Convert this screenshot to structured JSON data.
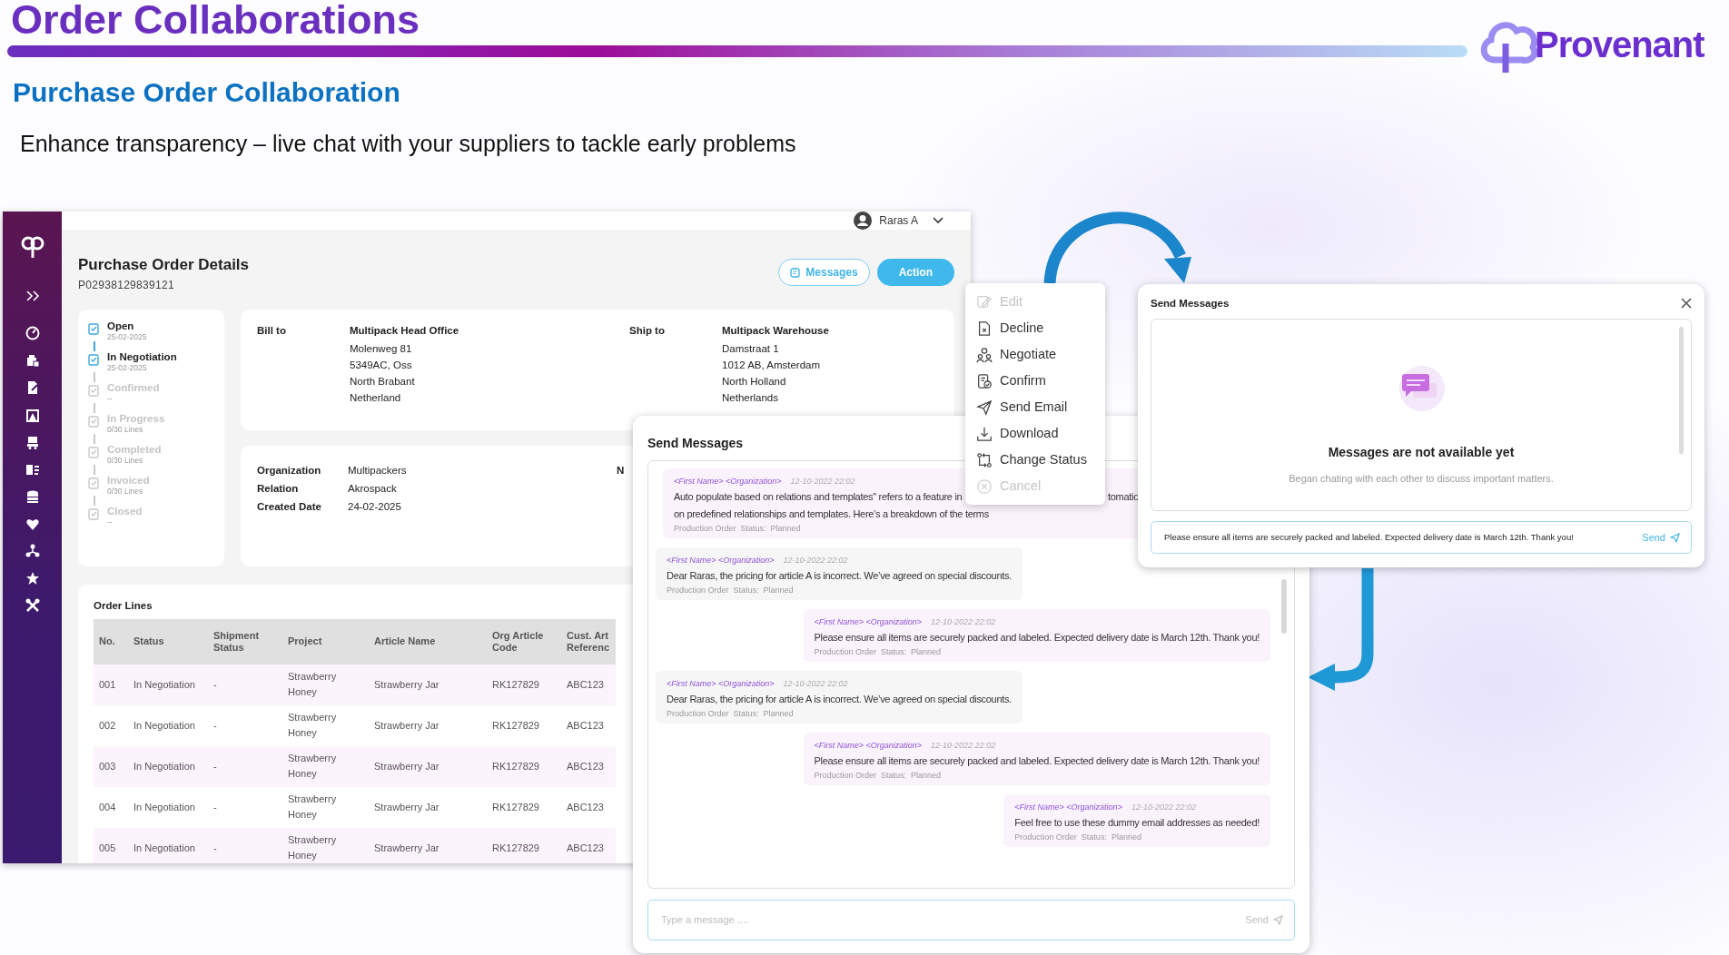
{
  "slide": {
    "title": "Order Collaborations",
    "subtitle": "Purchase Order Collaboration",
    "tagline": "Enhance transparency – live chat with your suppliers to tackle early problems",
    "logo": "Provenant"
  },
  "app": {
    "user": "Raras A",
    "page_title": "Purchase Order Details",
    "po_number": "P02938129839121",
    "buttons": [
      {
        "label": "Messages",
        "kind": "outline"
      },
      {
        "label": "Action",
        "kind": "solid"
      }
    ],
    "timeline": [
      {
        "label": "Open",
        "detail": "25-02-2025",
        "done": true
      },
      {
        "label": "In Negotiation",
        "detail": "25-02-2025",
        "done": true
      },
      {
        "label": "Confirmed",
        "detail": "--",
        "done": false
      },
      {
        "label": "In Progress",
        "detail": "0/30 Lines",
        "done": false
      },
      {
        "label": "Completed",
        "detail": "0/30 Lines",
        "done": false
      },
      {
        "label": "Invoiced",
        "detail": "0/30 Lines",
        "done": false
      },
      {
        "label": "Closed",
        "detail": "--",
        "done": false
      }
    ],
    "addresses": [
      {
        "label": "Bill to",
        "name": "Multipack Head Office",
        "lines": [
          "Molenweg 81",
          "5349AC, Oss",
          "North Brabant",
          "Netherland"
        ]
      },
      {
        "label": "Ship to",
        "name": "Multipack Warehouse",
        "lines": [
          "Damstraat 1",
          "1012 AB, Amsterdam",
          "North Holland",
          "Netherlands"
        ]
      }
    ],
    "details": [
      {
        "label": "Organization",
        "value": "Multipackers"
      },
      {
        "label": "Relation",
        "value": "Akrospack"
      },
      {
        "label": "Created Date",
        "value": "24-02-2025"
      }
    ],
    "details_column_2_label": "N",
    "order_lines": {
      "title": "Order Lines",
      "columns": [
        "No.",
        "Status",
        "Shipment Status",
        "Project",
        "Article Name",
        "Org Article Code",
        "Cust. Art Referenc"
      ],
      "rows": [
        [
          "001",
          "In Negotiation",
          "-",
          "Strawberry Honey",
          "Strawberry Jar",
          "RK127829",
          "ABC123"
        ],
        [
          "002",
          "In Negotiation",
          "-",
          "Strawberry Honey",
          "Strawberry Jar",
          "RK127829",
          "ABC123"
        ],
        [
          "003",
          "In Negotiation",
          "-",
          "Strawberry Honey",
          "Strawberry Jar",
          "RK127829",
          "ABC123"
        ],
        [
          "004",
          "In Negotiation",
          "-",
          "Strawberry Honey",
          "Strawberry Jar",
          "RK127829",
          "ABC123"
        ],
        [
          "005",
          "In Negotiation",
          "-",
          "Strawberry Honey",
          "Strawberry Jar",
          "RK127829",
          "ABC123"
        ]
      ]
    }
  },
  "chat_panel": {
    "title": "Send Messages",
    "messages": [
      {
        "kind": "outgoing",
        "sender": "<First Name> <Organization>",
        "time": "12-10-2022 22:02",
        "lines": [
          "Auto populate based on relations and templates\" refers to a feature in",
          "on predefined relationships and templates. Here’s a breakdown of the terms"
        ],
        "line_end_fragment": "tomatic",
        "meta": "Production Order  Status:  Planned"
      },
      {
        "kind": "incoming",
        "sender": "<First Name> <Organization>",
        "time": "12-10-2022 22:02",
        "lines": [
          "Dear Raras, the pricing for article A is incorrect. We’ve agreed on special discounts."
        ],
        "meta": "Production Order  Status:  Planned"
      },
      {
        "kind": "outgoing",
        "sender": "<First Name> <Organization>",
        "time": "12-10-2022 22:02",
        "lines": [
          "Please ensure all items are securely packed and labeled. Expected delivery date is March 12th. Thank you!"
        ],
        "meta": "Production Order  Status:  Planned"
      },
      {
        "kind": "incoming",
        "sender": "<First Name> <Organization>",
        "time": "12-10-2022 22:02",
        "lines": [
          "Dear Raras, the pricing for article A is incorrect. We’ve agreed on special discounts."
        ],
        "meta": "Production Order  Status:  Planned"
      },
      {
        "kind": "outgoing",
        "sender": "<First Name> <Organization>",
        "time": "12-10-2022 22:02",
        "lines": [
          "Please ensure all items are securely packed and labeled. Expected delivery date is March 12th. Thank you!"
        ],
        "meta": "Production Order  Status:  Planned"
      },
      {
        "kind": "outgoing",
        "sender": "<First Name> <Organization>",
        "time": "12-10-2022 22:02",
        "lines": [
          "Feel free to use these dummy email addresses as needed!"
        ],
        "meta": "Production Order  Status:  Planned"
      }
    ],
    "input": {
      "placeholder": "Type a message ....",
      "send": "Send",
      "send_disabled": true
    }
  },
  "action_menu": [
    {
      "label": "Edit",
      "disabled": true
    },
    {
      "label": "Decline",
      "disabled": false
    },
    {
      "label": "Negotiate",
      "disabled": false
    },
    {
      "label": "Confirm",
      "disabled": false
    },
    {
      "label": "Send Email",
      "disabled": false
    },
    {
      "label": "Download",
      "disabled": false
    },
    {
      "label": "Change Status",
      "disabled": false
    },
    {
      "label": "Cancel",
      "disabled": true
    }
  ],
  "popup": {
    "title": "Send Messages",
    "empty_title": "Messages are not available yet",
    "empty_text": "Began chating with each other to discuss important matters.",
    "input": {
      "value": "Please ensure all items are securely packed and labeled. Expected delivery date is March 12th. Thank you!",
      "send": "Send",
      "send_disabled": false
    }
  }
}
